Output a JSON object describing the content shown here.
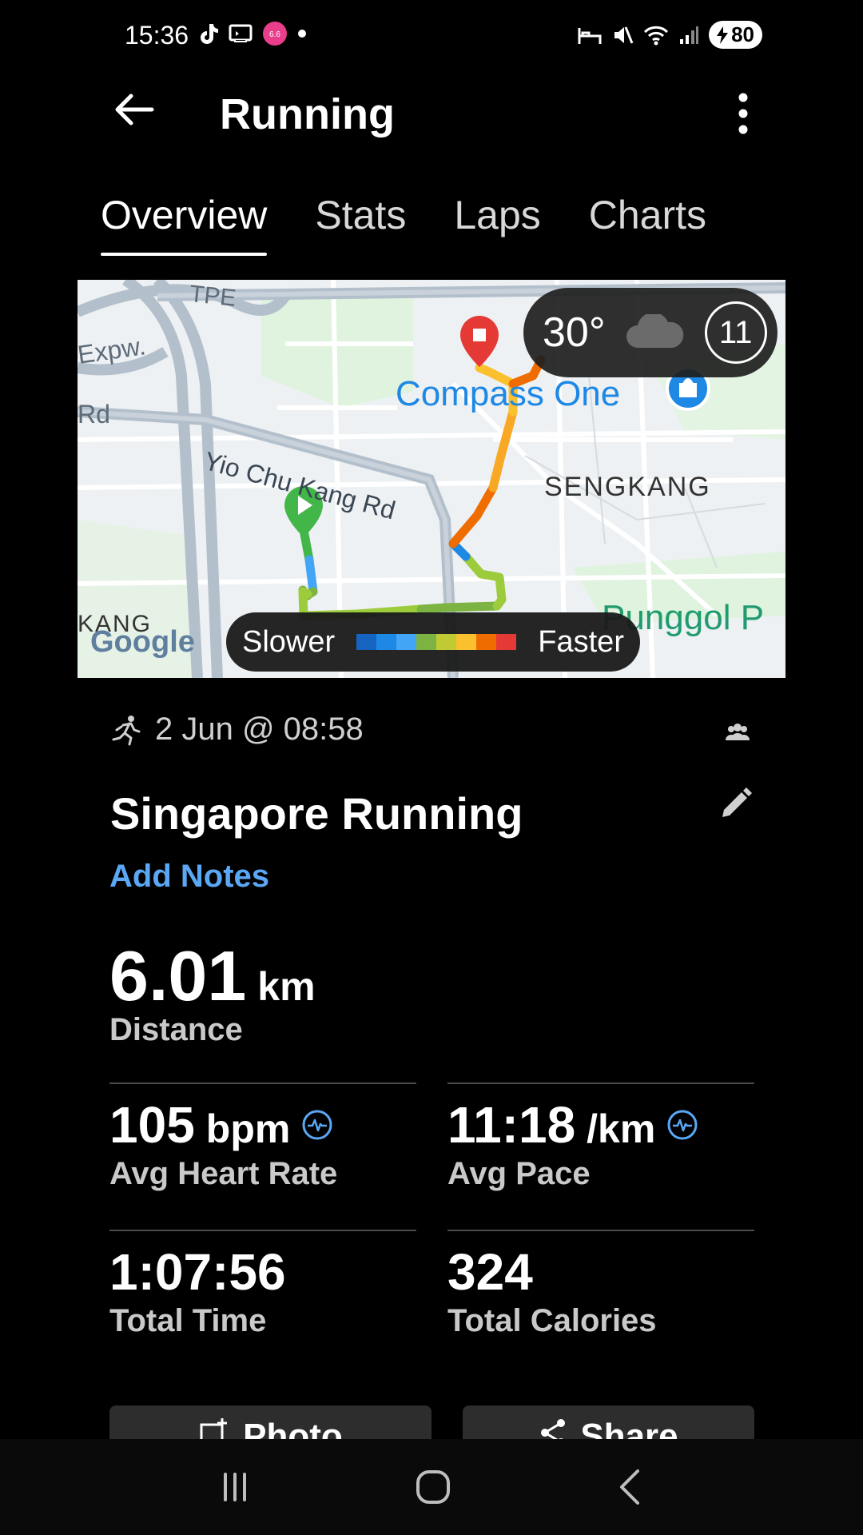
{
  "status_bar": {
    "time": "15:36",
    "battery": "80",
    "left_icons": [
      "tiktok-icon",
      "cast-icon",
      "lazada-icon",
      "dot-icon"
    ],
    "right_icons": [
      "bed-icon",
      "mute-icon",
      "wifi-icon",
      "signal-icon"
    ]
  },
  "header": {
    "title": "Running"
  },
  "tabs": [
    {
      "label": "Overview",
      "active": true
    },
    {
      "label": "Stats",
      "active": false
    },
    {
      "label": "Laps",
      "active": false
    },
    {
      "label": "Charts",
      "active": false
    }
  ],
  "map": {
    "labels": {
      "tpe": "TPE",
      "expw": "Expw.",
      "rd": "Rd",
      "yio_chu_kang": "Yio Chu Kang Rd",
      "compass_one": "Compass One",
      "sengkang": "SENGKANG",
      "kang": "KANG",
      "punggol": "Punggol P",
      "google": "Google"
    },
    "weather": {
      "temperature": "30°",
      "icon": "cloud-icon",
      "aqi": "11"
    },
    "legend": {
      "slower": "Slower",
      "faster": "Faster",
      "colors": [
        "#1565c0",
        "#1e88e5",
        "#42a5f5",
        "#7cb342",
        "#c0ca33",
        "#fbc02d",
        "#ef6c00",
        "#e53935"
      ]
    }
  },
  "activity": {
    "date": "2 Jun @ 08:58",
    "name": "Singapore Running",
    "add_notes": "Add Notes",
    "distance": {
      "value": "6.01",
      "unit": "km",
      "label": "Distance"
    },
    "stats": [
      {
        "value": "105",
        "unit": "bpm",
        "label": "Avg Heart Rate",
        "icon": "pulse-icon"
      },
      {
        "value": "11:18",
        "unit": "/km",
        "label": "Avg Pace",
        "icon": "pulse-icon"
      },
      {
        "value": "1:07:56",
        "unit": "",
        "label": "Total Time"
      },
      {
        "value": "324",
        "unit": "",
        "label": "Total Calories"
      }
    ]
  },
  "actions": {
    "photo": "Photo",
    "share": "Share"
  },
  "colors": {
    "accent_blue": "#5aa8f5",
    "background": "#000000",
    "route_start": "#43b649",
    "route_end": "#e53935"
  }
}
